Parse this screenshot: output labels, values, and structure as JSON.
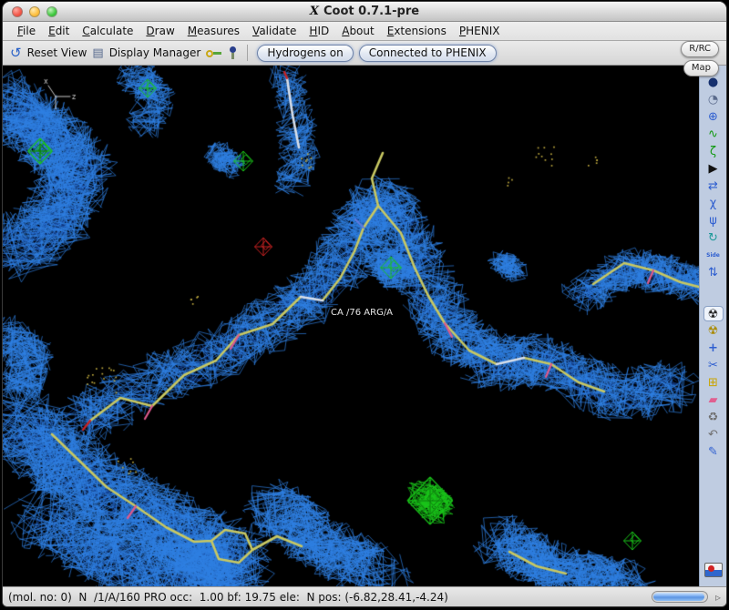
{
  "window": {
    "title": "Coot 0.7.1-pre"
  },
  "menubar": {
    "items": [
      {
        "label": "File"
      },
      {
        "label": "Edit"
      },
      {
        "label": "Calculate"
      },
      {
        "label": "Draw"
      },
      {
        "label": "Measures"
      },
      {
        "label": "Validate"
      },
      {
        "label": "HID"
      },
      {
        "label": "About"
      },
      {
        "label": "Extensions"
      },
      {
        "label": "PHENIX"
      }
    ]
  },
  "toolbar": {
    "reset_view": "Reset View",
    "display_manager": "Display Manager",
    "hydrogens_toggle": "Hydrogens on",
    "phenix_status": "Connected to PHENIX",
    "icons": {
      "reset_view_glyph": "↺",
      "display_manager_glyph": "▤"
    }
  },
  "corner_buttons": {
    "rrc": "R/RC",
    "map": "Map"
  },
  "side_toolbar": {
    "icons": [
      {
        "name": "sphere-icon",
        "glyph": "●"
      },
      {
        "name": "clock-display-icon",
        "glyph": "◔"
      },
      {
        "name": "move-zone-icon",
        "glyph": "⊕"
      },
      {
        "name": "real-space-refine-icon",
        "glyph": "∿"
      },
      {
        "name": "regularize-zone-icon",
        "glyph": "ζ"
      },
      {
        "name": "play-icon",
        "glyph": "▶"
      },
      {
        "name": "rotate-translate-icon",
        "glyph": "⇄"
      },
      {
        "name": "auto-fit-rotamer-icon",
        "glyph": "χ"
      },
      {
        "name": "rotamer-select-icon",
        "glyph": "ψ"
      },
      {
        "name": "torsion-edit-icon",
        "glyph": "↻"
      },
      {
        "name": "side-chain-180-icon",
        "glyph": "Side"
      },
      {
        "name": "flip-peptide-icon",
        "glyph": "⇅"
      },
      {
        "name": "refine-radiation-icon",
        "glyph": "☢"
      },
      {
        "name": "tandem-refine-icon",
        "glyph": "☢"
      },
      {
        "name": "add-atom-icon",
        "glyph": "+"
      },
      {
        "name": "cut-zone-icon",
        "glyph": "✂"
      },
      {
        "name": "add-residue-icon",
        "glyph": "⊞"
      },
      {
        "name": "highlight-residue-icon",
        "glyph": "▰"
      },
      {
        "name": "delete-item-icon",
        "glyph": "♻"
      },
      {
        "name": "undo-icon",
        "glyph": "↶"
      },
      {
        "name": "edit-icon",
        "glyph": "✎"
      }
    ]
  },
  "viewport": {
    "atom_label": "CA /76 ARG/A",
    "axes": {
      "x": "x",
      "z": "z"
    },
    "colors": {
      "background": "#000000",
      "mesh_blue": "#2f80e2",
      "mesh_dark_blue": "#1647a0",
      "map_green": "#1ac41a",
      "map_green_dark": "#0d7a0d",
      "map_red": "#cc2222",
      "stick_yellow": "#c8c862",
      "stick_white": "#d8dfea",
      "stick_pink": "#de5a8c",
      "stick_blue": "#5f7ce0",
      "water_yellow": "#b9a43c",
      "label_color": "#e6e6e6",
      "axis_color": "#c8c8c8"
    }
  },
  "statusbar": {
    "text": "(mol. no: 0)  N  /1/A/160 PRO occ:  1.00 bf: 19.75 ele:  N pos: (-6.82,28.41,-4.24)",
    "expander_glyph": "▹"
  }
}
